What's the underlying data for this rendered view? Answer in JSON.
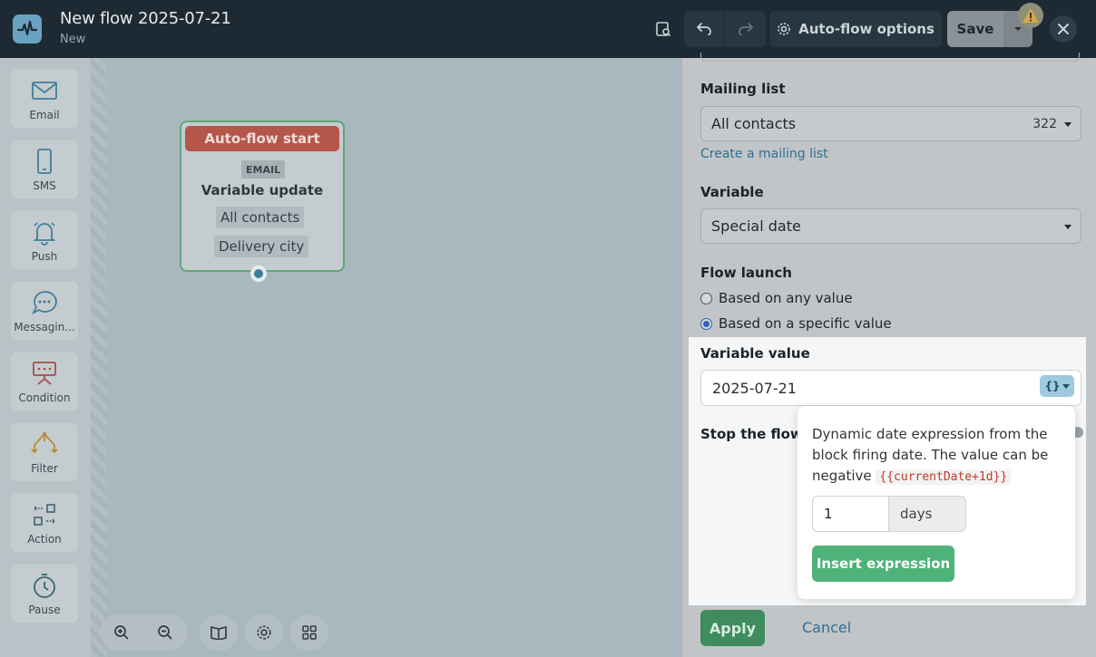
{
  "header": {
    "title": "New flow 2025-07-21",
    "subtitle": "New",
    "auto_flow_options_label": "Auto-flow options",
    "save_label": "Save"
  },
  "toolbox": {
    "items": [
      {
        "label": "Email",
        "icon": "envelope-icon"
      },
      {
        "label": "SMS",
        "icon": "phone-icon"
      },
      {
        "label": "Push",
        "icon": "bell-icon"
      },
      {
        "label": "Messagin...",
        "icon": "chat-bubble-icon"
      },
      {
        "label": "Condition",
        "icon": "condition-icon"
      },
      {
        "label": "Filter",
        "icon": "filter-icon"
      },
      {
        "label": "Action",
        "icon": "action-icon"
      },
      {
        "label": "Pause",
        "icon": "clock-icon"
      }
    ]
  },
  "canvas": {
    "node": {
      "header": "Auto-flow start",
      "badge": "EMAIL",
      "title": "Variable update",
      "chips": [
        "All contacts",
        "Delivery city"
      ]
    }
  },
  "panel": {
    "mailing_list": {
      "label": "Mailing list",
      "value": "All contacts",
      "count": "322",
      "create_link": "Create a mailing list"
    },
    "variable": {
      "label": "Variable",
      "value": "Special date"
    },
    "flow_launch": {
      "label": "Flow launch",
      "options": [
        {
          "label": "Based on any value",
          "checked": false
        },
        {
          "label": "Based on a specific value",
          "checked": true
        }
      ]
    },
    "variable_value": {
      "label": "Variable value",
      "value": "2025-07-21",
      "expr_button": "{}"
    },
    "stop_label": "Stop the flow",
    "popover": {
      "description": "Dynamic date expression from the block firing date. The value can be negative",
      "example": "{{currentDate+1d}}",
      "amount": "1",
      "unit": "days",
      "insert_label": "Insert expression"
    },
    "apply_label": "Apply",
    "cancel_label": "Cancel"
  }
}
